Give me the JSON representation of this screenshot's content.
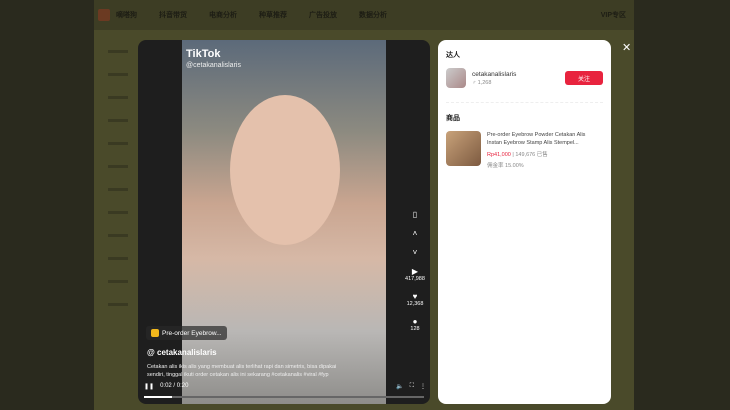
{
  "topbar": {
    "logo": "嘀嗒狗",
    "nav": [
      "抖音带货",
      "电商分析",
      "种草推荐",
      "广告投放",
      "数据分析"
    ],
    "vip": "VIP专区"
  },
  "video": {
    "brand": "TikTok",
    "watermark_handle": "@cetakanalislaris",
    "product_chip": "Pre-order Eyebrow...",
    "author": "@ cetakanalislaris",
    "caption": "Cetakan alis ikis alis yang membuat alis terlihat rapi dan simetris, bisa dipakai sendiri, tinggal ikuti order cetakan alis ini sekarang #cetakanalis #viral #fyp",
    "time": "0:02 / 0:20",
    "progress": 0.1,
    "plays": "417,988",
    "likes": "12,368",
    "comments": "128"
  },
  "panel": {
    "creator_heading": "达人",
    "creator_name": "cetakanalislaris",
    "fans": "1,268",
    "follow": "关注",
    "product_heading": "商品",
    "product_title": "Pre-order Eyebrow Powder Cetakan Alis Instan Eyebrow Stamp Alis Stempel...",
    "price": "Rp41,000",
    "sold": "149,676 已售",
    "commission": "佣金率 15.00%"
  },
  "colors": {
    "accent": "#e8233e"
  }
}
